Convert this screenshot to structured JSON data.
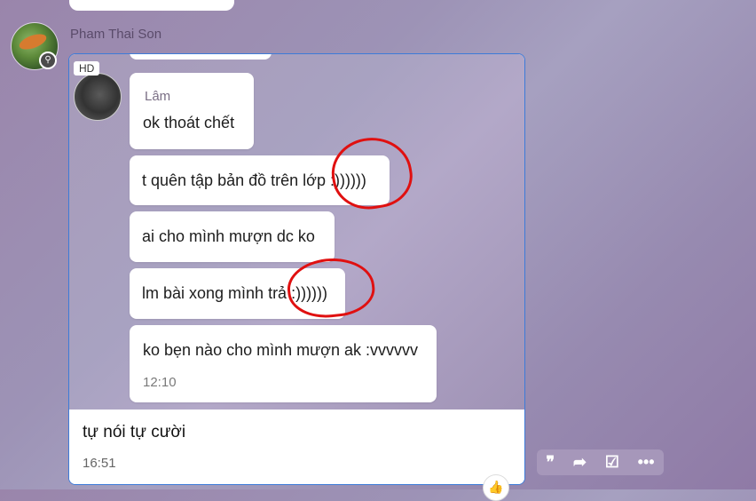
{
  "sender": {
    "name": "Pham Thai Son"
  },
  "screenshot": {
    "hd_label": "HD",
    "messages": [
      {
        "name": "Lâm",
        "text": "ok thoát chết"
      },
      {
        "text": "t quên tập bản đồ trên lớp :))))))"
      },
      {
        "text": "ai cho mình mượn dc ko"
      },
      {
        "text": "lm bài xong mình trả :))))))"
      },
      {
        "text": "ko bẹn nào cho mình mượn ak :vvvvvv",
        "time": "12:10"
      }
    ]
  },
  "caption": {
    "text": "tự nói tự cười",
    "time": "16:51"
  },
  "actions": {
    "quote_icon": "quote-icon",
    "forward_icon": "forward-icon",
    "task_icon": "task-icon",
    "more_icon": "more-icon"
  },
  "colors": {
    "card_border": "#3d7bd8",
    "annotation": "#e01010"
  }
}
